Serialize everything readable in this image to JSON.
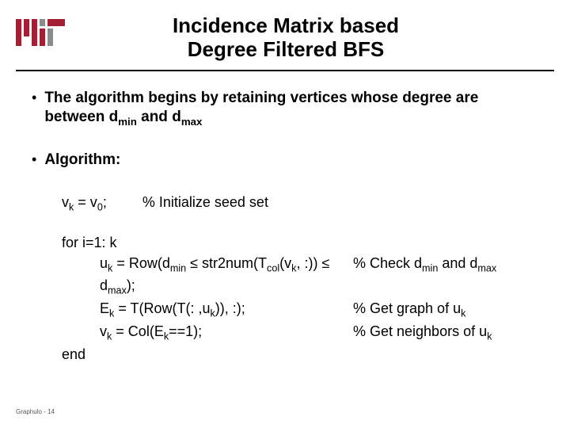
{
  "title_line1": "Incidence Matrix based",
  "title_line2": "Degree Filtered BFS",
  "bullets": {
    "b1_pre": "The algorithm begins by retaining vertices whose degree are between d",
    "b1_min": "min",
    "b1_mid": " and d",
    "b1_max": "max",
    "b2": "Algorithm:"
  },
  "algo": {
    "init_code": "v",
    "init_sub": "k",
    "init_rest": " = v",
    "init_sub2": "0",
    "init_end": ";",
    "init_cmt": "% Initialize seed set",
    "for_line": "for i=1: k",
    "l1_a": "u",
    "l1_as": "k",
    "l1_b": " = Row(d",
    "l1_bs": "min",
    "l1_c": " ≤ str2num(T",
    "l1_cs": "col",
    "l1_d": "(v",
    "l1_ds": "k",
    "l1_e": ", :)) ≤ d",
    "l1_es": "max",
    "l1_f": ");",
    "l1_cmt_a": "% Check d",
    "l1_cmt_as": "min",
    "l1_cmt_b": " and d",
    "l1_cmt_bs": "max",
    "l2_a": "E",
    "l2_as": "k",
    "l2_b": " = T(Row(T(: ,u",
    "l2_bs": "k",
    "l2_c": ")), :);",
    "l2_cmt_a": "% Get graph of u",
    "l2_cmt_as": "k",
    "l3_a": "v",
    "l3_as": "k",
    "l3_b": " = Col(E",
    "l3_bs": "k",
    "l3_c": "==1);",
    "l3_cmt_a": "% Get neighbors of u",
    "l3_cmt_as": "k",
    "end_line": "end"
  },
  "footer": "Graphulo - 14"
}
